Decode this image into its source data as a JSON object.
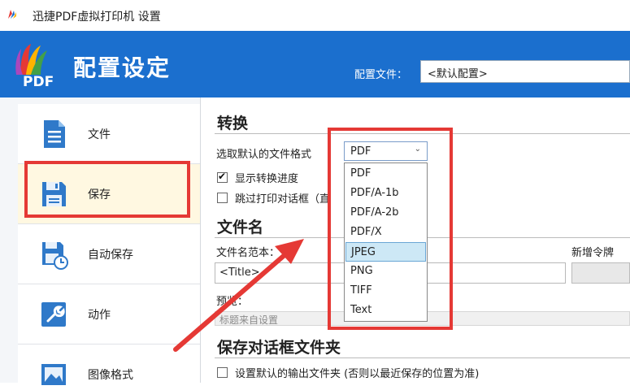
{
  "window": {
    "title": "迅捷PDF虚拟打印机 设置"
  },
  "header": {
    "logo_text": "PDF",
    "title": "配置设定",
    "profile_label": "配置文件：",
    "profile_value": "<默认配置>"
  },
  "sidebar": {
    "items": [
      {
        "label": "文件",
        "icon": "document-icon"
      },
      {
        "label": "保存",
        "icon": "save-icon",
        "active": true
      },
      {
        "label": "自动保存",
        "icon": "autosave-icon"
      },
      {
        "label": "动作",
        "icon": "wrench-icon"
      },
      {
        "label": "图像格式",
        "icon": "image-icon"
      }
    ]
  },
  "conversion": {
    "heading": "转换",
    "format_label": "选取默认的文件格式",
    "format_value": "PDF",
    "format_options": [
      "PDF",
      "PDF/A-1b",
      "PDF/A-2b",
      "PDF/X",
      "JPEG",
      "PNG",
      "TIFF",
      "Text"
    ],
    "highlighted_option": "JPEG",
    "show_progress_label": "显示转换进度",
    "show_progress_checked": true,
    "skip_print_dialog_label": "跳过打印对话框（直",
    "skip_print_dialog_checked": false
  },
  "filename": {
    "heading": "文件名",
    "template_label": "文件名范本：",
    "add_token_label": "新增令牌",
    "template_value": "<Title>",
    "preview_label": "预览：",
    "preview_value": "标题来自设置"
  },
  "save_dialog": {
    "heading": "保存对话框文件夹",
    "default_folder_label": "设置默认的输出文件夹 (否则以最近保存的位置为准)",
    "default_folder_checked": false
  },
  "colors": {
    "header_bg": "#1b6fce",
    "highlight_red": "#e53935",
    "selected_option": "#cde8f6",
    "active_item_bg": "#fff8e1"
  }
}
